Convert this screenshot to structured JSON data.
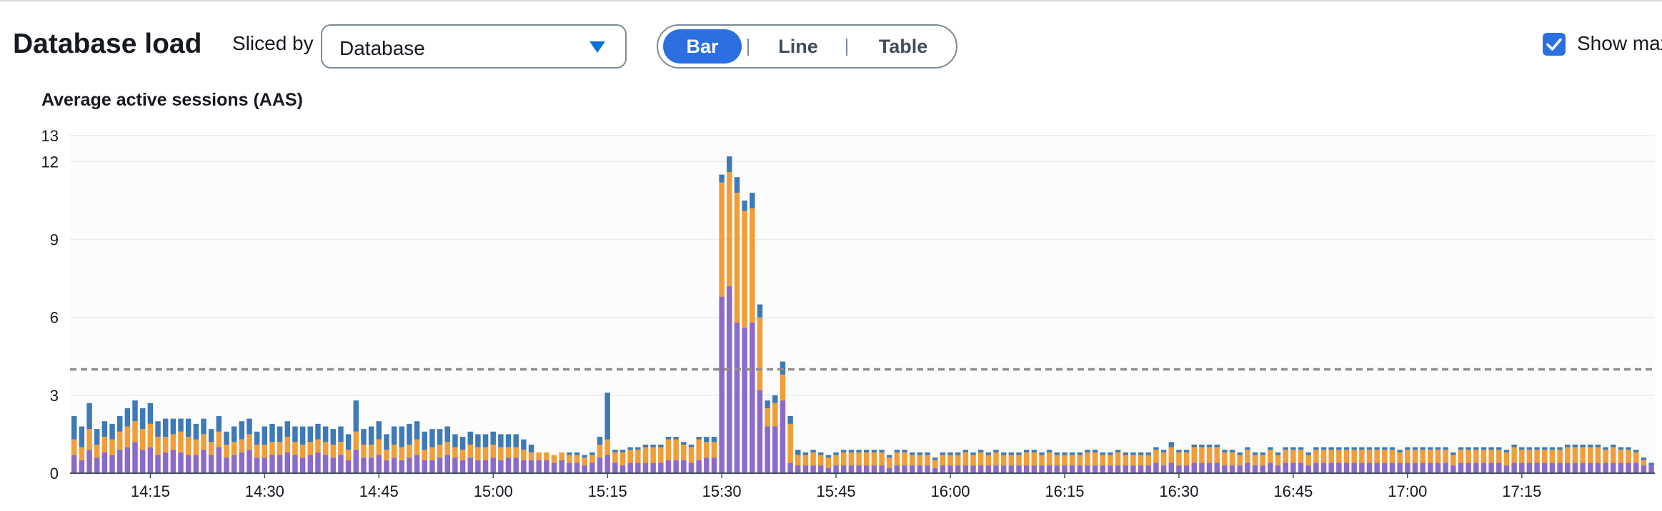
{
  "header": {
    "title": "Database load",
    "sliced_by_label": "Sliced by",
    "slice_select_value": "Database",
    "view_buttons": [
      "Bar",
      "Line",
      "Table"
    ],
    "active_view": "Bar",
    "show_max_label": "Show max",
    "show_max_checked": true
  },
  "colors": {
    "series_1": "#8c6ac8",
    "series_2": "#f19e38",
    "series_3": "#3e7ab6",
    "max_line": "#8d8d8d",
    "accent": "#2b6fe0"
  },
  "chart_data": {
    "type": "bar",
    "stacked": true,
    "title": "Average active sessions (AAS)",
    "xlabel": "",
    "ylabel": "",
    "ylim": [
      0,
      13
    ],
    "yticks": [
      0,
      3,
      6,
      9,
      12,
      13
    ],
    "xticks": [
      "14:15",
      "14:30",
      "14:45",
      "15:00",
      "15:15",
      "15:30",
      "15:45",
      "16:00",
      "16:15",
      "16:30",
      "16:45",
      "17:00",
      "17:15"
    ],
    "x_start": "14:05",
    "x_step_minutes": 1,
    "max_line_value": 4.0,
    "grid": true,
    "legend": "none",
    "series": [
      {
        "values": [
          0.7,
          0.5,
          0.9,
          0.6,
          0.8,
          0.7,
          0.9,
          1.0,
          1.2,
          0.9,
          1.0,
          0.7,
          0.8,
          0.9,
          0.8,
          0.7,
          0.7,
          0.9,
          0.7,
          1.0,
          0.6,
          0.7,
          0.8,
          0.9,
          0.6,
          0.6,
          0.7,
          0.7,
          0.8,
          0.7,
          0.6,
          0.7,
          0.8,
          0.7,
          0.6,
          0.7,
          0.5,
          0.9,
          0.6,
          0.6,
          0.7,
          0.5,
          0.6,
          0.5,
          0.6,
          0.7,
          0.5,
          0.5,
          0.6,
          0.7,
          0.6,
          0.5,
          0.6,
          0.5,
          0.5,
          0.6,
          0.5,
          0.6,
          0.6,
          0.5,
          0.5,
          0.5,
          0.5,
          0.4,
          0.5,
          0.4,
          0.4,
          0.3,
          0.4,
          0.6,
          0.7,
          0.4,
          0.3,
          0.4,
          0.4,
          0.4,
          0.4,
          0.4,
          0.5,
          0.5,
          0.5,
          0.4,
          0.5,
          0.6,
          0.6,
          6.8,
          7.2,
          5.8,
          5.6,
          5.8,
          3.2,
          1.8,
          1.8,
          2.8,
          0.4,
          0.3,
          0.3,
          0.3,
          0.3,
          0.2,
          0.3,
          0.3,
          0.3,
          0.3,
          0.3,
          0.3,
          0.3,
          0.2,
          0.3,
          0.3,
          0.3,
          0.3,
          0.3,
          0.2,
          0.3,
          0.3,
          0.3,
          0.3,
          0.3,
          0.3,
          0.3,
          0.3,
          0.3,
          0.3,
          0.3,
          0.3,
          0.3,
          0.3,
          0.3,
          0.3,
          0.3,
          0.3,
          0.3,
          0.3,
          0.3,
          0.3,
          0.3,
          0.3,
          0.3,
          0.3,
          0.3,
          0.3,
          0.4,
          0.3,
          0.4,
          0.3,
          0.3,
          0.4,
          0.4,
          0.4,
          0.4,
          0.3,
          0.3,
          0.3,
          0.4,
          0.3,
          0.3,
          0.4,
          0.3,
          0.4,
          0.4,
          0.4,
          0.3,
          0.4,
          0.4,
          0.4,
          0.4,
          0.4,
          0.4,
          0.4,
          0.4,
          0.4,
          0.4,
          0.4,
          0.4,
          0.4,
          0.4,
          0.4,
          0.4,
          0.4,
          0.4,
          0.3,
          0.4,
          0.4,
          0.4,
          0.4,
          0.4,
          0.4,
          0.3,
          0.4,
          0.4,
          0.4,
          0.4,
          0.4,
          0.4,
          0.4,
          0.4,
          0.4,
          0.4,
          0.4,
          0.4,
          0.4,
          0.4,
          0.4,
          0.4,
          0.4,
          0.3,
          0.3
        ]
      },
      {
        "values": [
          0.6,
          0.5,
          0.8,
          0.5,
          0.6,
          0.6,
          0.7,
          0.8,
          0.8,
          0.8,
          0.9,
          0.7,
          0.6,
          0.6,
          0.8,
          0.7,
          0.6,
          0.6,
          0.5,
          0.6,
          0.5,
          0.5,
          0.5,
          0.6,
          0.5,
          0.5,
          0.5,
          0.5,
          0.6,
          0.5,
          0.5,
          0.5,
          0.5,
          0.5,
          0.5,
          0.5,
          0.4,
          0.7,
          0.5,
          0.5,
          0.6,
          0.4,
          0.5,
          0.5,
          0.5,
          0.6,
          0.4,
          0.5,
          0.5,
          0.5,
          0.4,
          0.4,
          0.5,
          0.5,
          0.5,
          0.5,
          0.5,
          0.4,
          0.4,
          0.4,
          0.3,
          0.3,
          0.3,
          0.3,
          0.3,
          0.3,
          0.3,
          0.3,
          0.3,
          0.5,
          0.6,
          0.4,
          0.5,
          0.5,
          0.5,
          0.6,
          0.6,
          0.6,
          0.8,
          0.8,
          0.6,
          0.6,
          0.8,
          0.6,
          0.6,
          4.4,
          4.4,
          5.0,
          4.5,
          4.4,
          2.8,
          0.7,
          0.9,
          1.0,
          1.5,
          0.4,
          0.4,
          0.5,
          0.4,
          0.4,
          0.4,
          0.5,
          0.5,
          0.5,
          0.5,
          0.5,
          0.5,
          0.4,
          0.5,
          0.5,
          0.4,
          0.4,
          0.4,
          0.3,
          0.4,
          0.4,
          0.4,
          0.5,
          0.4,
          0.5,
          0.4,
          0.5,
          0.4,
          0.4,
          0.4,
          0.5,
          0.5,
          0.4,
          0.5,
          0.4,
          0.4,
          0.4,
          0.4,
          0.5,
          0.5,
          0.4,
          0.4,
          0.5,
          0.4,
          0.4,
          0.4,
          0.4,
          0.5,
          0.5,
          0.6,
          0.5,
          0.5,
          0.6,
          0.6,
          0.6,
          0.6,
          0.5,
          0.5,
          0.4,
          0.5,
          0.4,
          0.4,
          0.5,
          0.4,
          0.5,
          0.5,
          0.5,
          0.4,
          0.5,
          0.5,
          0.5,
          0.5,
          0.5,
          0.5,
          0.5,
          0.5,
          0.5,
          0.5,
          0.5,
          0.4,
          0.5,
          0.5,
          0.5,
          0.5,
          0.5,
          0.5,
          0.4,
          0.5,
          0.5,
          0.5,
          0.5,
          0.5,
          0.5,
          0.5,
          0.6,
          0.5,
          0.5,
          0.5,
          0.5,
          0.5,
          0.5,
          0.6,
          0.6,
          0.6,
          0.6,
          0.6,
          0.5,
          0.6,
          0.5,
          0.5,
          0.4,
          0.2
        ]
      },
      {
        "values": [
          0.9,
          0.8,
          1.0,
          0.6,
          0.6,
          0.6,
          0.6,
          0.7,
          0.8,
          0.8,
          0.8,
          0.6,
          0.7,
          0.6,
          0.5,
          0.7,
          0.6,
          0.6,
          0.5,
          0.6,
          0.5,
          0.6,
          0.7,
          0.6,
          0.5,
          0.7,
          0.7,
          0.6,
          0.6,
          0.6,
          0.7,
          0.6,
          0.6,
          0.6,
          0.6,
          0.6,
          0.6,
          1.2,
          0.6,
          0.7,
          0.7,
          0.6,
          0.7,
          0.8,
          0.8,
          0.7,
          0.7,
          0.7,
          0.6,
          0.6,
          0.5,
          0.5,
          0.5,
          0.5,
          0.5,
          0.5,
          0.5,
          0.5,
          0.5,
          0.4,
          0.3,
          0.0,
          0.0,
          0.0,
          0.0,
          0.1,
          0.1,
          0.1,
          0.1,
          0.3,
          1.8,
          0.1,
          0.1,
          0.1,
          0.1,
          0.1,
          0.1,
          0.1,
          0.1,
          0.1,
          0.1,
          0.1,
          0.1,
          0.2,
          0.2,
          0.3,
          0.6,
          0.6,
          0.4,
          0.6,
          0.5,
          0.3,
          0.3,
          0.5,
          0.3,
          0.2,
          0.1,
          0.1,
          0.1,
          0.1,
          0.1,
          0.1,
          0.1,
          0.1,
          0.1,
          0.1,
          0.1,
          0.1,
          0.1,
          0.1,
          0.1,
          0.1,
          0.1,
          0.1,
          0.1,
          0.1,
          0.1,
          0.1,
          0.1,
          0.1,
          0.1,
          0.1,
          0.1,
          0.1,
          0.1,
          0.1,
          0.1,
          0.1,
          0.1,
          0.1,
          0.1,
          0.1,
          0.1,
          0.1,
          0.1,
          0.1,
          0.1,
          0.1,
          0.1,
          0.1,
          0.1,
          0.1,
          0.1,
          0.1,
          0.2,
          0.1,
          0.1,
          0.1,
          0.1,
          0.1,
          0.1,
          0.1,
          0.1,
          0.1,
          0.1,
          0.1,
          0.1,
          0.1,
          0.1,
          0.1,
          0.1,
          0.1,
          0.1,
          0.1,
          0.1,
          0.1,
          0.1,
          0.1,
          0.1,
          0.1,
          0.1,
          0.1,
          0.1,
          0.1,
          0.1,
          0.1,
          0.1,
          0.1,
          0.1,
          0.1,
          0.1,
          0.1,
          0.1,
          0.1,
          0.1,
          0.1,
          0.1,
          0.1,
          0.1,
          0.1,
          0.1,
          0.1,
          0.1,
          0.1,
          0.1,
          0.1,
          0.1,
          0.1,
          0.1,
          0.1,
          0.1,
          0.1,
          0.1,
          0.1,
          0.1,
          0.1,
          0.1,
          0.1,
          0.1,
          0.1
        ]
      }
    ]
  }
}
